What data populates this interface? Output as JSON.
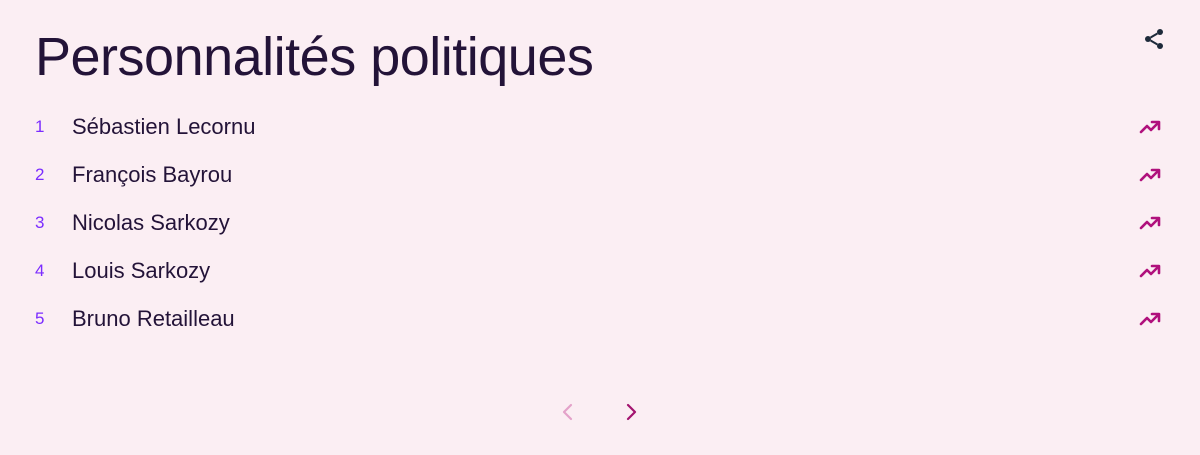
{
  "title": "Personnalités politiques",
  "items": [
    {
      "rank": "1",
      "name": "Sébastien Lecornu"
    },
    {
      "rank": "2",
      "name": "François Bayrou"
    },
    {
      "rank": "3",
      "name": "Nicolas Sarkozy"
    },
    {
      "rank": "4",
      "name": "Louis Sarkozy"
    },
    {
      "rank": "5",
      "name": "Bruno Retailleau"
    }
  ],
  "icons": {
    "share": "share-icon",
    "trend": "trending-up-icon",
    "prev": "chevron-left-icon",
    "next": "chevron-right-icon"
  },
  "colors": {
    "background": "#fbeef3",
    "title": "#231338",
    "rank": "#7b2cff",
    "trend": "#b0107c",
    "pager_disabled": "#e3a2c9",
    "pager_active": "#a3146f"
  }
}
